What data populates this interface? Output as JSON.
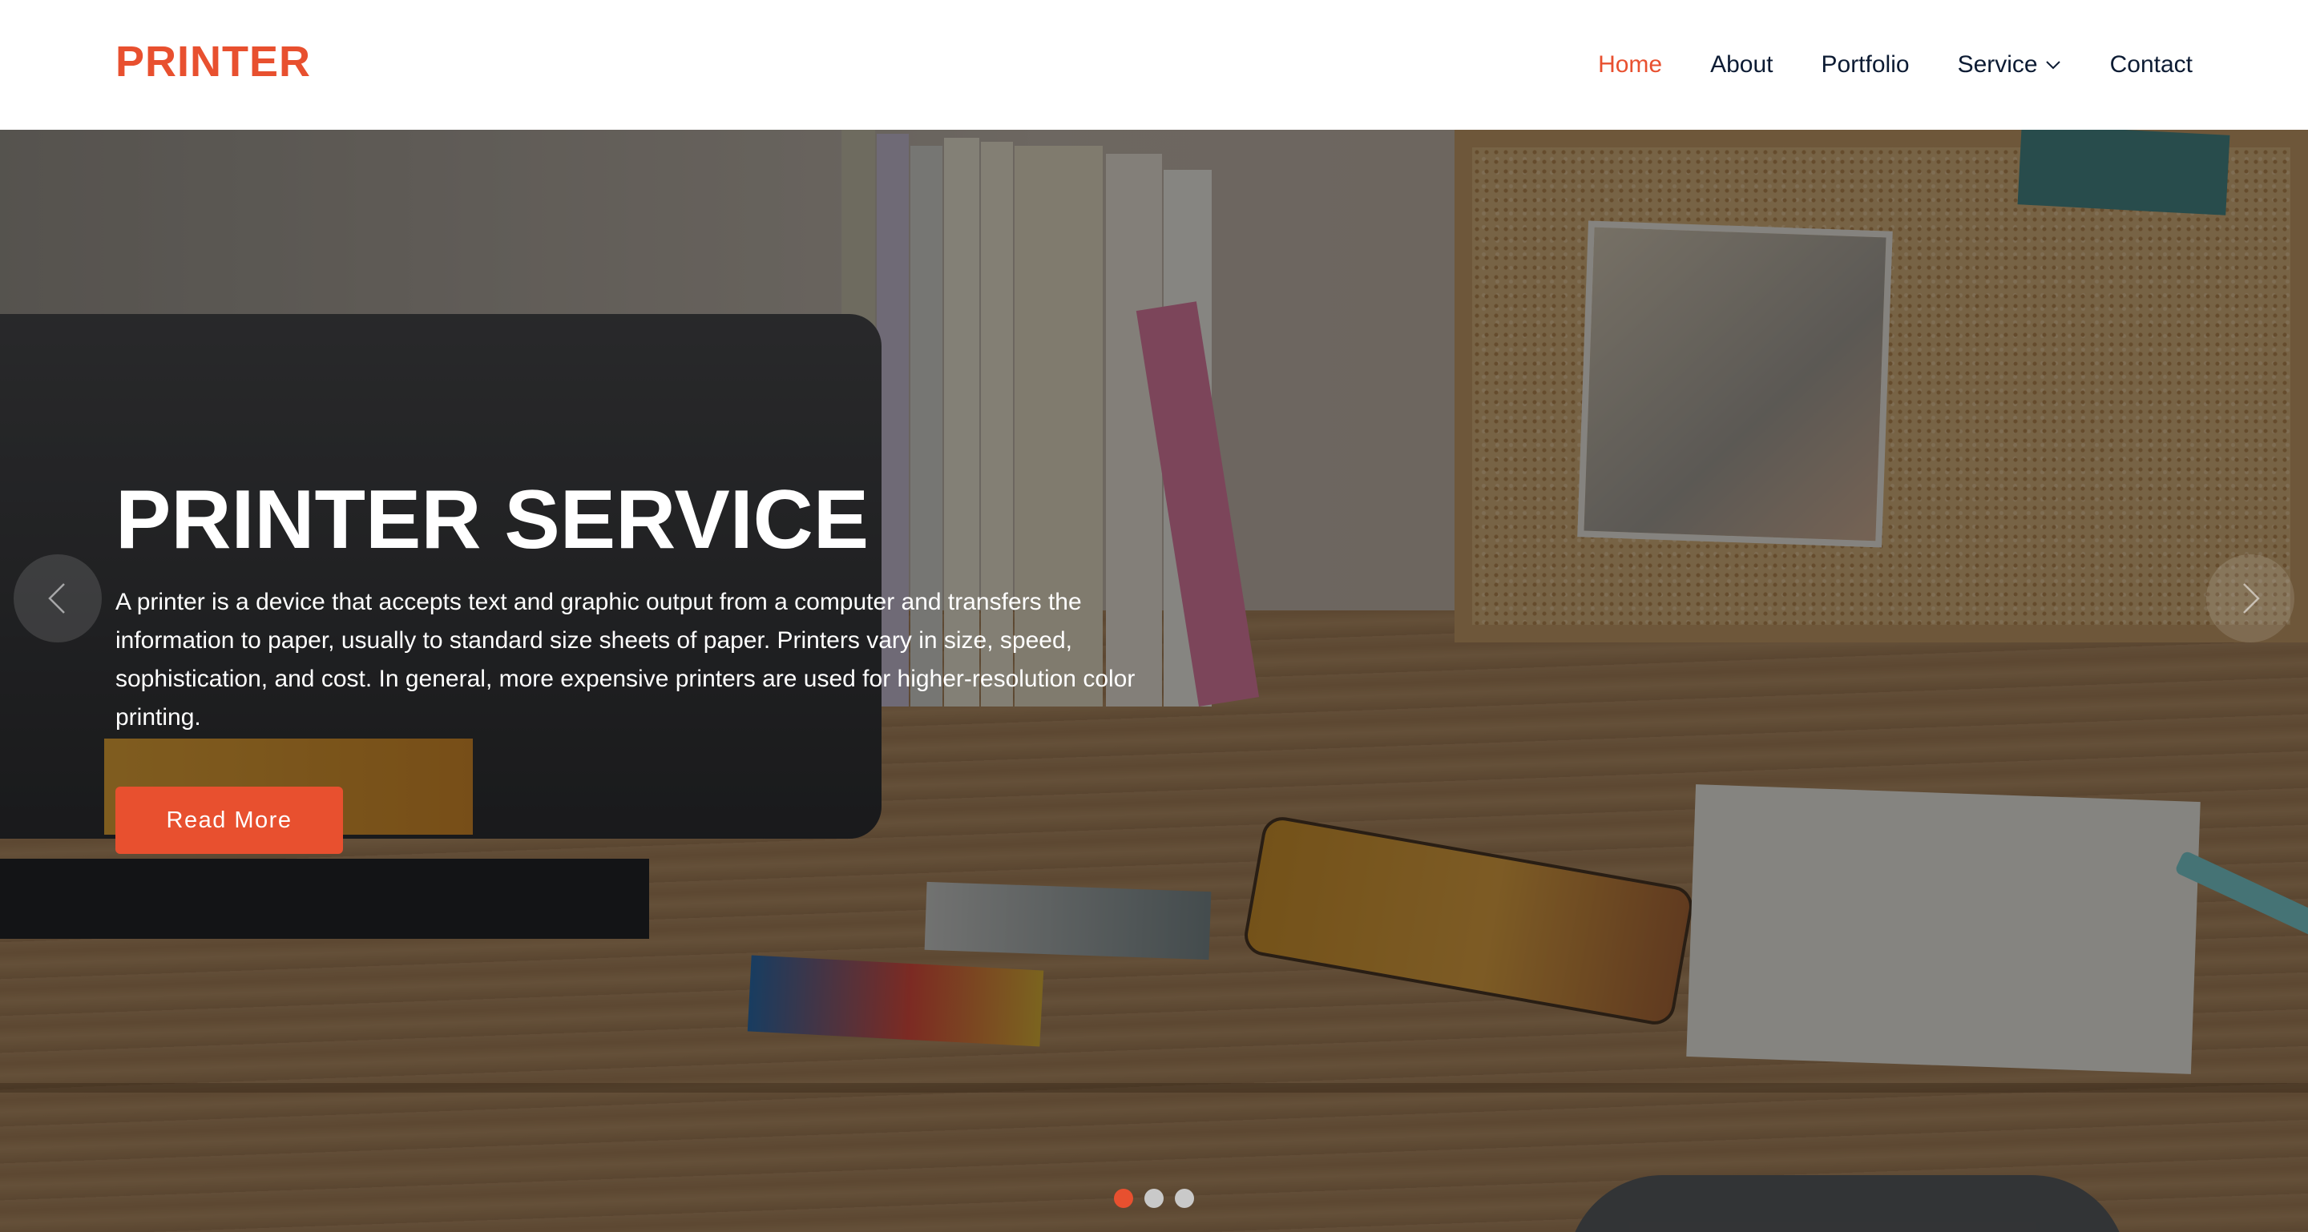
{
  "brand": {
    "logo_text": "PRINTER",
    "accent_color": "#e8502f",
    "nav_text_color": "#0c1b33"
  },
  "nav": {
    "items": [
      {
        "label": "Home",
        "active": true
      },
      {
        "label": "About",
        "active": false
      },
      {
        "label": "Portfolio",
        "active": false
      },
      {
        "label": "Service",
        "active": false,
        "has_dropdown": true,
        "icon": "chevron-down-icon"
      },
      {
        "label": "Contact",
        "active": false
      }
    ]
  },
  "hero": {
    "title": "PRINTER SERVICE",
    "description": "A printer is a device that accepts text and graphic output from a computer and transfers the information to paper, usually to standard size sheets of paper. Printers vary in size, speed, sophistication, and cost. In general, more expensive printers are used for higher-resolution color printing.",
    "button_label": "Read More",
    "prev_icon": "chevron-left-icon",
    "next_icon": "chevron-right-icon",
    "slides": {
      "count": 3,
      "active_index": 0
    }
  }
}
